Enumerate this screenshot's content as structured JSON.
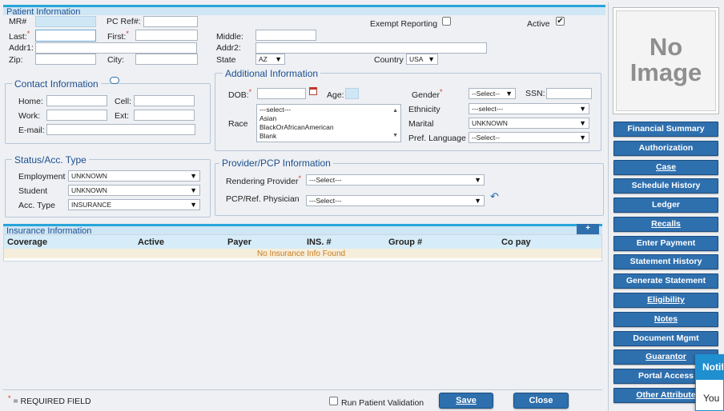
{
  "patient": {
    "header": "Patient Information",
    "mr_label": "MR#",
    "pcref_label": "PC Ref#:",
    "last_label": "Last:",
    "first_label": "First:",
    "middle_label": "Middle:",
    "addr1_label": "Addr1:",
    "addr2_label": "Addr2:",
    "zip_label": "Zip:",
    "city_label": "City:",
    "state_label": "State",
    "state_value": "AZ",
    "country_label": "Country",
    "country_value": "USA",
    "exempt_label": "Exempt Reporting",
    "active_label": "Active",
    "active_checked": "✔"
  },
  "contact": {
    "legend": "Contact Information",
    "home_label": "Home:",
    "cell_label": "Cell:",
    "work_label": "Work:",
    "ext_label": "Ext:",
    "email_label": "E-mail:"
  },
  "additional": {
    "legend": "Additional Information",
    "dob_label": "DOB:",
    "age_label": "Age:",
    "gender_label": "Gender",
    "gender_value": "--Select--",
    "ssn_label": "SSN:",
    "race_label": "Race",
    "race_options": [
      "---select---",
      "Asian",
      "BlackOrAfricanAmerican",
      "Blank"
    ],
    "ethnicity_label": "Ethnicity",
    "ethnicity_value": "---select---",
    "marital_label": "Marital",
    "marital_value": "UNKNOWN",
    "language_label": "Pref. Language",
    "language_value": "--Select--"
  },
  "status": {
    "legend": "Status/Acc. Type",
    "employment_label": "Employment",
    "employment_value": "UNKNOWN",
    "student_label": "Student",
    "student_value": "UNKNOWN",
    "acctype_label": "Acc. Type",
    "acctype_value": "INSURANCE"
  },
  "provider": {
    "legend": "Provider/PCP Information",
    "rendering_label": "Rendering Provider",
    "rendering_value": "---Select---",
    "pcp_label": "PCP/Ref. Physician",
    "pcp_value": "---Select---"
  },
  "insurance": {
    "header": "Insurance Information",
    "add_symbol": "+",
    "columns": [
      "Coverage",
      "Active",
      "Payer",
      "INS. #",
      "Group #",
      "Co pay"
    ],
    "empty_text": "No Insurance Info Found"
  },
  "photo": {
    "line1": "No",
    "line2": "Image"
  },
  "sidebar": {
    "items": [
      {
        "label": "Financial Summary"
      },
      {
        "label": "Authorization"
      },
      {
        "label": "Case"
      },
      {
        "label": "Schedule History"
      },
      {
        "label": "Ledger"
      },
      {
        "label": "Recalls"
      },
      {
        "label": "Enter Payment"
      },
      {
        "label": "Statement History"
      },
      {
        "label": "Generate Statement"
      },
      {
        "label": "Eligibility"
      },
      {
        "label": "Notes"
      },
      {
        "label": "Document Mgmt"
      },
      {
        "label": "Guarantor"
      },
      {
        "label": "Portal Access"
      },
      {
        "label": "Other Attribute"
      }
    ]
  },
  "footer": {
    "required_star": "*",
    "required_text": "= REQUIRED FIELD",
    "validation_label": "Run Patient Validation",
    "save_label": "Save",
    "close_label": "Close"
  },
  "notification": {
    "title": "Notifi",
    "body": "You"
  },
  "colors": {
    "accent": "#2e6fae",
    "header_bar": "#27a5d8",
    "legend_text": "#1d4f8f"
  }
}
